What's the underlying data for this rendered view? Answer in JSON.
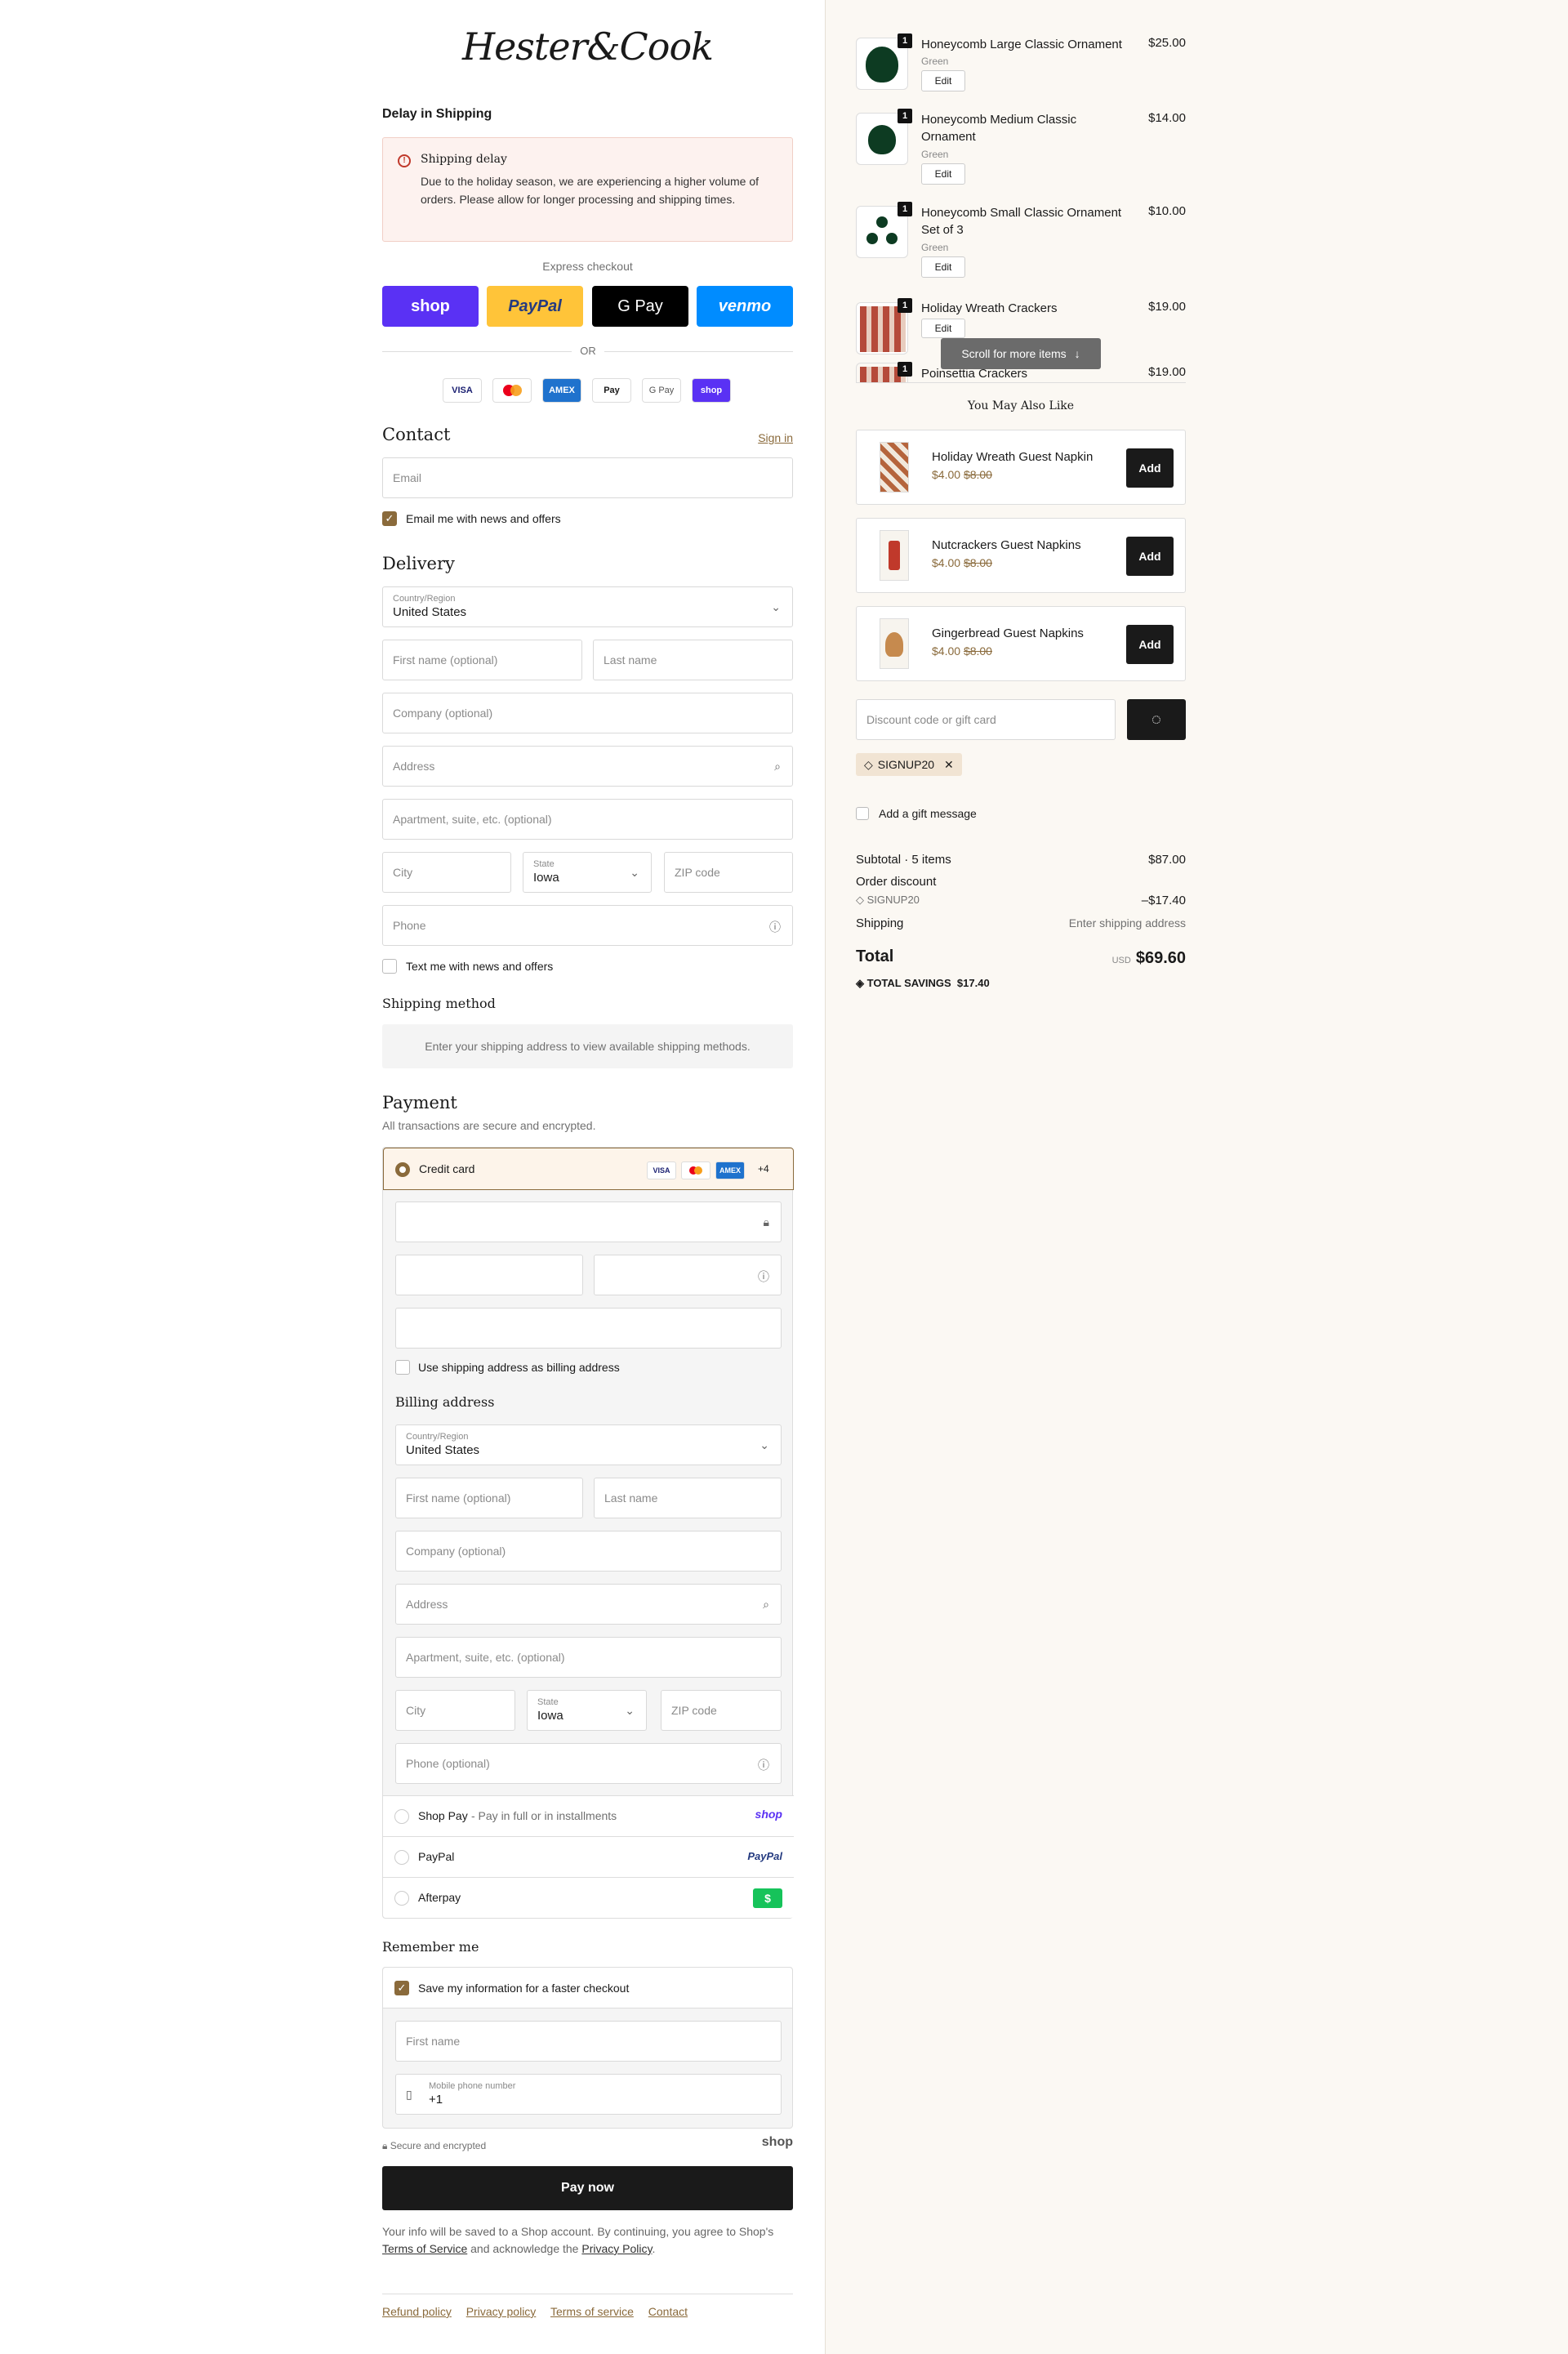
{
  "brand": {
    "logo_text": "Hester&Cook"
  },
  "notice": {
    "heading": "Delay in Shipping",
    "title": "Shipping delay",
    "body": "Due to the holiday season, we are experiencing a higher volume of orders. Please allow for longer processing and shipping times."
  },
  "express": {
    "label": "Express checkout",
    "buttons": [
      {
        "label": "shop",
        "color": "#5a31f4"
      },
      {
        "label": "PayPal",
        "color": "#ffc439"
      },
      {
        "label": "G Pay",
        "color": "#000000"
      },
      {
        "label": "venmo",
        "color": "#008cff"
      }
    ],
    "or_label": "OR",
    "card_logos": [
      "VISA",
      "MC",
      "AMEX",
      "Pay",
      "G Pay",
      "shop"
    ]
  },
  "contact": {
    "title": "Contact",
    "sign_in": "Sign in",
    "email_placeholder": "Email",
    "news_label": "Email me with news and offers"
  },
  "delivery": {
    "title": "Delivery",
    "country_label": "Country/Region",
    "country_value": "United States",
    "first_name": "First name (optional)",
    "last_name": "Last name",
    "company": "Company (optional)",
    "address": "Address",
    "apartment": "Apartment, suite, etc. (optional)",
    "city": "City",
    "state_label": "State",
    "state_value": "Iowa",
    "zip": "ZIP code",
    "phone": "Phone",
    "text_label": "Text me with news and offers"
  },
  "shipping": {
    "title": "Shipping method",
    "message": "Enter your shipping address to view available shipping methods."
  },
  "payment": {
    "title": "Payment",
    "subtitle": "All transactions are secure and encrypted.",
    "credit_card_label": "Credit card",
    "more_count": "+4",
    "use_shipping_label": "Use shipping address as billing address",
    "billing_title": "Billing address",
    "billing": {
      "country_label": "Country/Region",
      "country_value": "United States",
      "first_name": "First name (optional)",
      "last_name": "Last name",
      "company": "Company (optional)",
      "address": "Address",
      "apartment": "Apartment, suite, etc. (optional)",
      "city": "City",
      "state_label": "State",
      "state_value": "Iowa",
      "zip": "ZIP code",
      "phone": "Phone (optional)"
    },
    "methods": [
      {
        "label": "Shop Pay",
        "sub": " - Pay in full or in installments",
        "logo": "shop"
      },
      {
        "label": "PayPal",
        "sub": "",
        "logo": "PayPal"
      },
      {
        "label": "Afterpay",
        "sub": "",
        "logo": "$"
      }
    ]
  },
  "remember": {
    "title": "Remember me",
    "save_label": "Save my information for a faster checkout",
    "first_name": "First name",
    "mobile_label": "Mobile phone number",
    "mobile_value": "+1"
  },
  "secure": {
    "label": "Secure and encrypted",
    "shop": "shop"
  },
  "pay_now": "Pay now",
  "legal": {
    "pre": "Your info will be saved to a Shop account. By continuing, you agree to Shop's ",
    "tos": "Terms of Service",
    "mid": " and acknowledge the ",
    "privacy": "Privacy Policy",
    "post": "."
  },
  "footer_links": [
    "Refund policy",
    "Privacy policy",
    "Terms of service",
    "Contact"
  ],
  "cart": {
    "items": [
      {
        "name": "Honeycomb Large Classic Ornament",
        "variant": "Green",
        "price": "$25.00",
        "qty": "1",
        "edit": "Edit"
      },
      {
        "name": "Honeycomb Medium Classic Ornament",
        "variant": "Green",
        "price": "$14.00",
        "qty": "1",
        "edit": "Edit"
      },
      {
        "name": "Honeycomb Small Classic Ornament Set of 3",
        "variant": "Green",
        "price": "$10.00",
        "qty": "1",
        "edit": "Edit"
      },
      {
        "name": "Holiday Wreath Crackers",
        "variant": "",
        "price": "$19.00",
        "qty": "1",
        "edit": "Edit"
      },
      {
        "name": "Poinsettia Crackers",
        "variant": "",
        "price": "$19.00",
        "qty": "1",
        "edit": ""
      }
    ],
    "scroll_hint": "Scroll for more items"
  },
  "upsell": {
    "title": "You May Also Like",
    "items": [
      {
        "name": "Holiday Wreath Guest Napkin",
        "price": "$4.00",
        "old_price": "$8.00",
        "add": "Add"
      },
      {
        "name": "Nutcrackers Guest Napkins",
        "price": "$4.00",
        "old_price": "$8.00",
        "add": "Add"
      },
      {
        "name": "Gingerbread Guest Napkins",
        "price": "$4.00",
        "old_price": "$8.00",
        "add": "Add"
      }
    ]
  },
  "discount": {
    "placeholder": "Discount code or gift card",
    "code": "SIGNUP20"
  },
  "gift_label": "Add a gift message",
  "summary": {
    "subtotal_label": "Subtotal · 5 items",
    "subtotal_value": "$87.00",
    "discount_label": "Order discount",
    "discount_code": "SIGNUP20",
    "discount_value": "–$17.40",
    "shipping_label": "Shipping",
    "shipping_value": "Enter shipping address",
    "total_label": "Total",
    "currency": "USD",
    "total_value": "$69.60",
    "savings_label": "TOTAL SAVINGS",
    "savings_value": "$17.40"
  }
}
